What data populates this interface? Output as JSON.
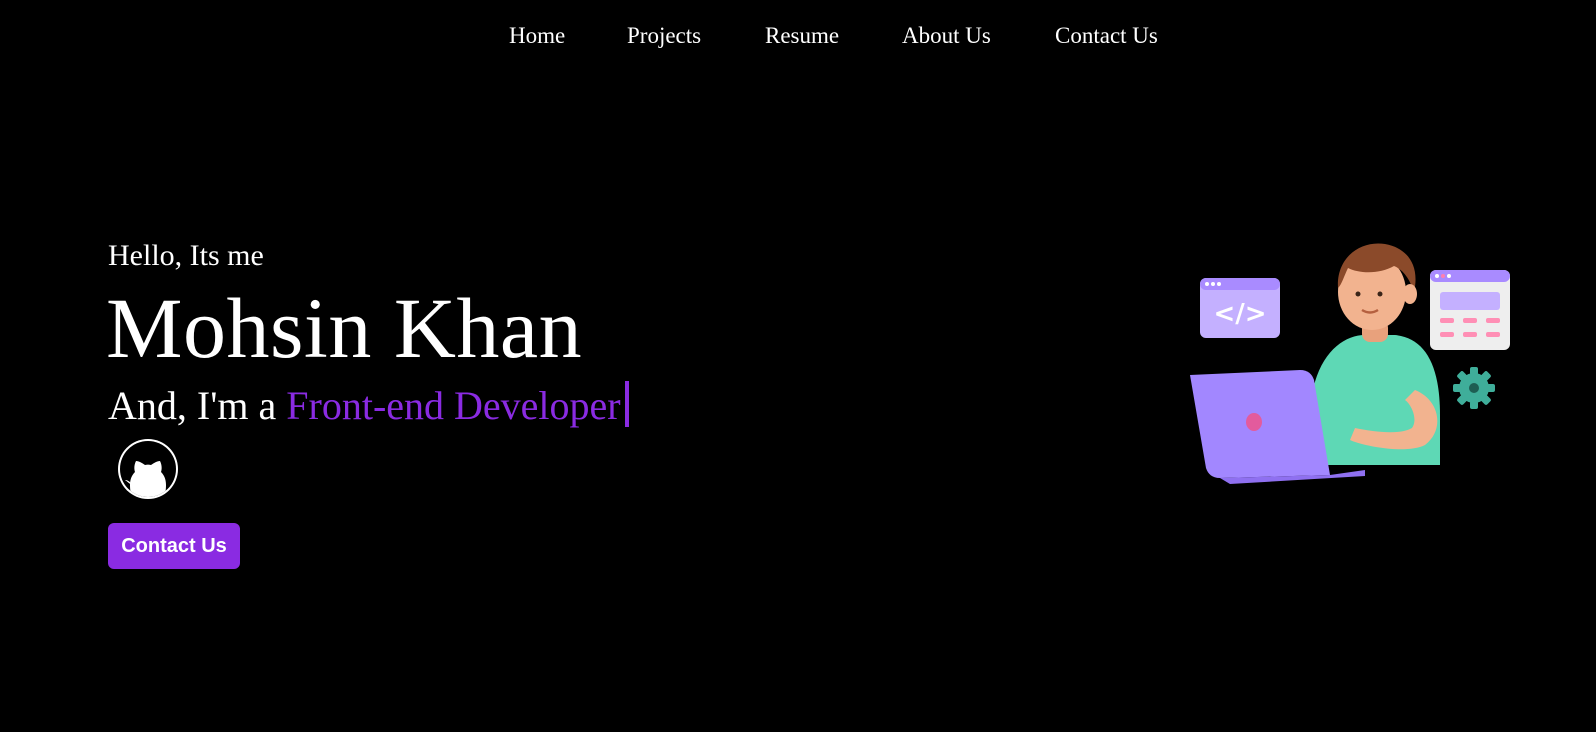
{
  "nav": {
    "items": [
      "Home",
      "Projects",
      "Resume",
      "About Us",
      "Contact Us"
    ]
  },
  "hero": {
    "greeting": "Hello, Its me",
    "name": "Mohsin Khan",
    "role_prefix": "And, I'm a ",
    "role_typed": "Front-end Developer",
    "contact_button": "Contact Us"
  },
  "social": {
    "github_icon": "github-icon"
  },
  "illustration": {
    "code_window_text": "</>"
  },
  "colors": {
    "background": "#000000",
    "text": "#ffffff",
    "accent": "#8a2be2"
  }
}
